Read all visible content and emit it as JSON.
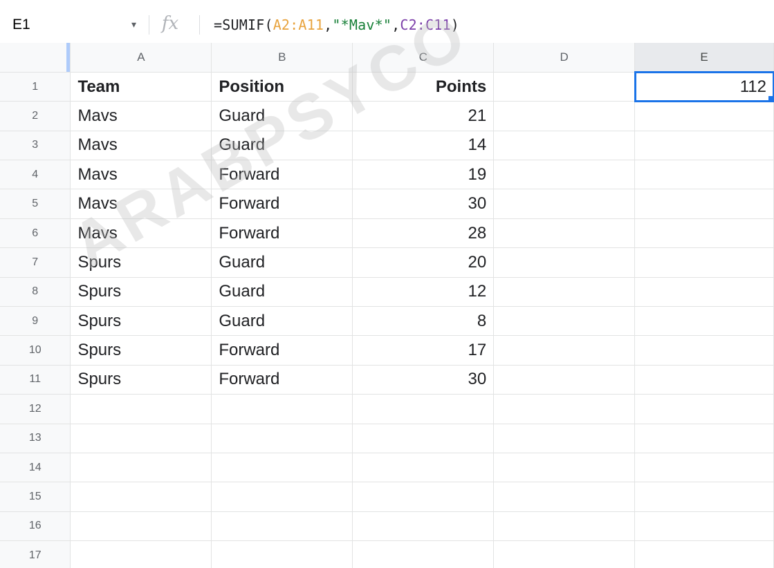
{
  "formula_bar": {
    "name_box": "E1",
    "caret": "▾",
    "fx": "fx",
    "formula": {
      "fn_open": "=SUMIF(",
      "range1": "A2:A11",
      "comma1": ",",
      "criteria": "\"*Mav*\"",
      "comma2": ",",
      "range2": "C2:C11",
      "close": ")"
    }
  },
  "columns": [
    "A",
    "B",
    "C",
    "D",
    "E"
  ],
  "rows": [
    {
      "n": "1",
      "a": "Team",
      "b": "Position",
      "c": "Points",
      "d": "",
      "e": "112"
    },
    {
      "n": "2",
      "a": "Mavs",
      "b": "Guard",
      "c": "21",
      "d": "",
      "e": ""
    },
    {
      "n": "3",
      "a": "Mavs",
      "b": "Guard",
      "c": "14",
      "d": "",
      "e": ""
    },
    {
      "n": "4",
      "a": "Mavs",
      "b": "Forward",
      "c": "19",
      "d": "",
      "e": ""
    },
    {
      "n": "5",
      "a": "Mavs",
      "b": "Forward",
      "c": "30",
      "d": "",
      "e": ""
    },
    {
      "n": "6",
      "a": "Mavs",
      "b": "Forward",
      "c": "28",
      "d": "",
      "e": ""
    },
    {
      "n": "7",
      "a": "Spurs",
      "b": "Guard",
      "c": "20",
      "d": "",
      "e": ""
    },
    {
      "n": "8",
      "a": "Spurs",
      "b": "Guard",
      "c": "12",
      "d": "",
      "e": ""
    },
    {
      "n": "9",
      "a": "Spurs",
      "b": "Guard",
      "c": "8",
      "d": "",
      "e": ""
    },
    {
      "n": "10",
      "a": "Spurs",
      "b": "Forward",
      "c": "17",
      "d": "",
      "e": ""
    },
    {
      "n": "11",
      "a": "Spurs",
      "b": "Forward",
      "c": "30",
      "d": "",
      "e": ""
    },
    {
      "n": "12",
      "a": "",
      "b": "",
      "c": "",
      "d": "",
      "e": ""
    },
    {
      "n": "13",
      "a": "",
      "b": "",
      "c": "",
      "d": "",
      "e": ""
    },
    {
      "n": "14",
      "a": "",
      "b": "",
      "c": "",
      "d": "",
      "e": ""
    },
    {
      "n": "15",
      "a": "",
      "b": "",
      "c": "",
      "d": "",
      "e": ""
    },
    {
      "n": "16",
      "a": "",
      "b": "",
      "c": "",
      "d": "",
      "e": ""
    },
    {
      "n": "17",
      "a": "",
      "b": "",
      "c": "",
      "d": "",
      "e": ""
    }
  ],
  "watermark": "ARABPSYCO",
  "colors": {
    "selection": "#1a73e8",
    "range1": "#e8a33d",
    "criteria": "#188038",
    "range2": "#7b3ea9"
  }
}
